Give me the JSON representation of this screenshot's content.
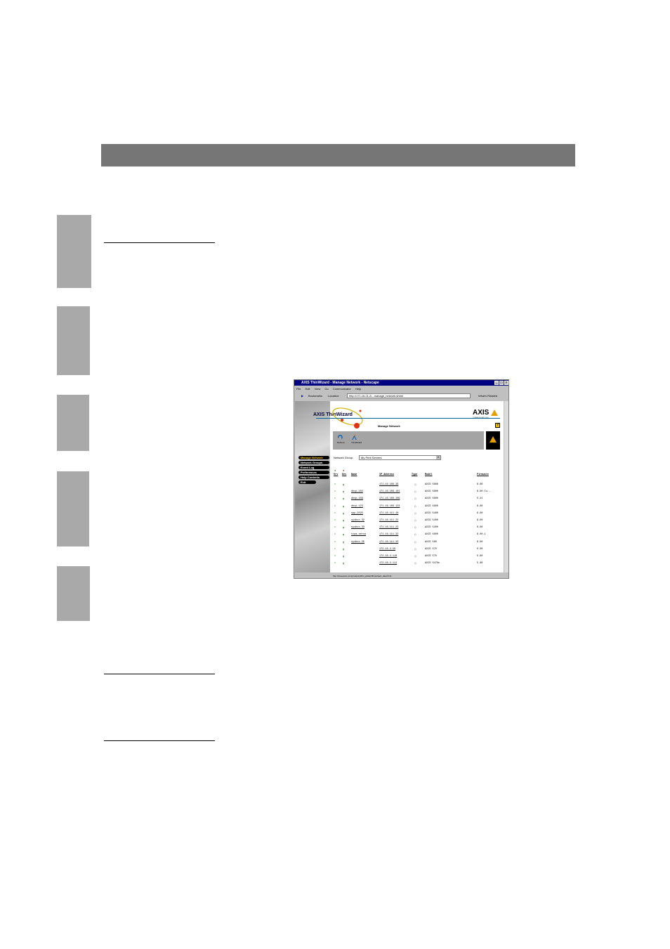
{
  "browser": {
    "title": "AXIS ThinWizard - Manage Network - Netscape",
    "menu": [
      "File",
      "Edit",
      "View",
      "Go",
      "Communicator",
      "Help"
    ],
    "bookmarks_label": "Bookmarks",
    "location_label": "Location:",
    "location_url": "http://171.16.21.2/...manage_network.shtml",
    "whats_related": "What's Related",
    "status_url": "http://www.axis.com/products/thin_wizard/thinwizard_data.html"
  },
  "app": {
    "logo": "AXIS ThinWizard",
    "brand": "AXIS",
    "brand_sub": "COMMUNICATIONS",
    "heading": "Manage Network",
    "help": "?",
    "tools": [
      {
        "icon": "refresh-icon",
        "label": "Refresh"
      },
      {
        "icon": "thinwizard-icon",
        "label": "ThinWizard"
      }
    ],
    "nav": [
      "Manage Network",
      "Network Groups",
      "Event Log",
      "Preferences",
      "Help Contents",
      "Exit"
    ],
    "network_group_label": "Network Group:",
    "network_group_value": "My Print Servers",
    "columns": [
      "Srv",
      "Dev",
      "Name",
      "IP Address",
      "Type",
      "Model",
      "Firmware"
    ],
    "rows": [
      {
        "name": "",
        "ip": "171.16.109.39",
        "model": "AXIS 5600",
        "fw": "6.00"
      },
      {
        "name": "dhcp-102",
        "ip": "171.16.109.101",
        "model": "AXIS 5600",
        "fw": "6.00.Cu..."
      },
      {
        "name": "dhcp-109",
        "ip": "171.16.109.109",
        "model": "AXIS 5600",
        "fw": "5.41"
      },
      {
        "name": "dhcp-123",
        "ip": "171.16.109.123",
        "model": "AXIS 5600",
        "fw": "0.00"
      },
      {
        "name": "npp-2025",
        "ip": "171.16.111.10",
        "model": "AXIS 5400",
        "fw": "6.00"
      },
      {
        "name": "sysbox-32",
        "ip": "171.16.111.22",
        "model": "AXIS 5400",
        "fw": "6.00"
      },
      {
        "name": "sysbox-33",
        "ip": "171.16.111.23",
        "model": "AXIS 5400",
        "fw": "6.00"
      },
      {
        "name": "tcpa-serca",
        "ip": "171.16.111.32",
        "model": "AXIS 5600",
        "fw": "6.00.1"
      },
      {
        "name": "sysbox-35",
        "ip": "171.16.111.33",
        "model": "AXIS 560",
        "fw": "6.00"
      },
      {
        "name": "",
        "ip": "172.16.2.55",
        "model": "AXIS 570",
        "fw": "0.00"
      },
      {
        "name": "",
        "ip": "172.16.2.110",
        "model": "AXIS 570",
        "fw": "5.80"
      },
      {
        "name": "",
        "ip": "172.16.2.111",
        "model": "AXIS 5470e",
        "fw": "5.80"
      }
    ]
  }
}
